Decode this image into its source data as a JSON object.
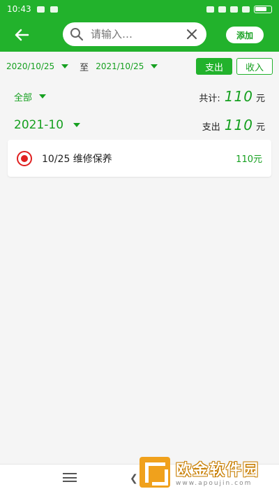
{
  "status_bar": {
    "time": "10:43"
  },
  "header": {
    "search_placeholder": "请输入…",
    "add_label": "添加"
  },
  "filter": {
    "start_date": "2020/10/25",
    "to_label": "至",
    "end_date": "2021/10/25",
    "expense_label": "支出",
    "income_label": "收入"
  },
  "summary": {
    "category": "全部",
    "total_label": "共计:",
    "total_amount": "110",
    "unit": "元"
  },
  "month_group": {
    "month": "2021-10",
    "type_label": "支出",
    "amount": "110",
    "unit": "元"
  },
  "records": [
    {
      "title": "10/25  维修保养",
      "amount": "110元"
    }
  ],
  "watermark": {
    "name": "欧金软件园",
    "url": "www.apoujin.com"
  },
  "colors": {
    "primary": "#22b22c",
    "accent_text": "#16a020",
    "record_icon": "#e02020"
  }
}
